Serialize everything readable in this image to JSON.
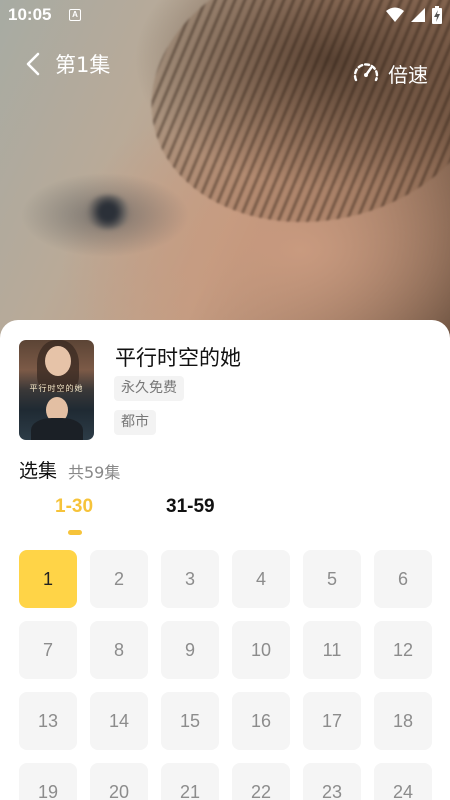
{
  "status_bar": {
    "time": "10:05",
    "notification_badge": "A"
  },
  "player": {
    "episode_title": "第1集",
    "speed_label": "倍速"
  },
  "drama": {
    "title": "平行时空的她",
    "cover_title": "平行时空的她",
    "tags": [
      "永久免费",
      "都市"
    ]
  },
  "episode_selector": {
    "title": "选集",
    "count_label": "共59集",
    "range_tabs": [
      {
        "label": "1-30",
        "active": true
      },
      {
        "label": "31-59",
        "active": false
      }
    ],
    "episodes": [
      "1",
      "2",
      "3",
      "4",
      "5",
      "6",
      "7",
      "8",
      "9",
      "10",
      "11",
      "12",
      "13",
      "14",
      "15",
      "16",
      "17",
      "18",
      "19",
      "20",
      "21",
      "22",
      "23",
      "24"
    ],
    "current_episode": "1"
  },
  "colors": {
    "accent": "#ffd447",
    "accent_text": "#f6c33a",
    "cell_bg": "#f5f5f5",
    "cell_text": "#8c8c8c"
  }
}
